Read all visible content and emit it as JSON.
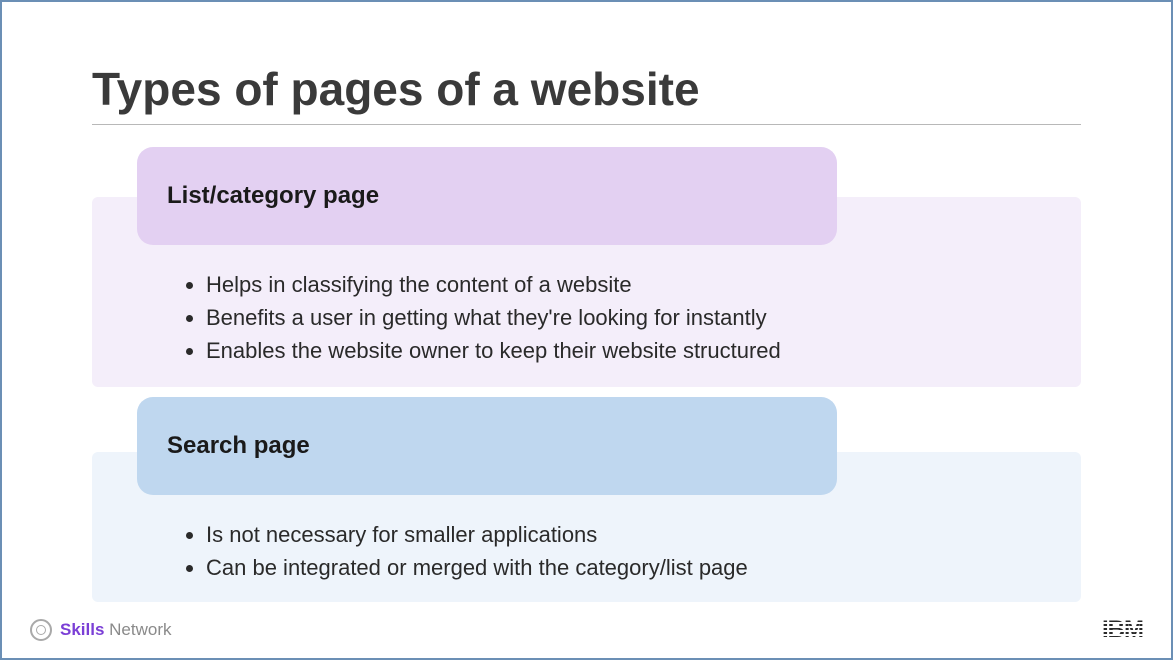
{
  "title": "Types of pages of a website",
  "sections": [
    {
      "heading": "List/category page",
      "bullets": [
        "Helps in classifying the content of a website",
        "Benefits a user in getting what they're looking for instantly",
        "Enables the website owner to keep their website structured"
      ]
    },
    {
      "heading": "Search page",
      "bullets": [
        "Is not necessary for smaller applications",
        "Can be integrated or merged with the category/list page"
      ]
    }
  ],
  "footer": {
    "brand_bold": "Skills",
    "brand_light": "Network",
    "right_logo": "IBM"
  }
}
